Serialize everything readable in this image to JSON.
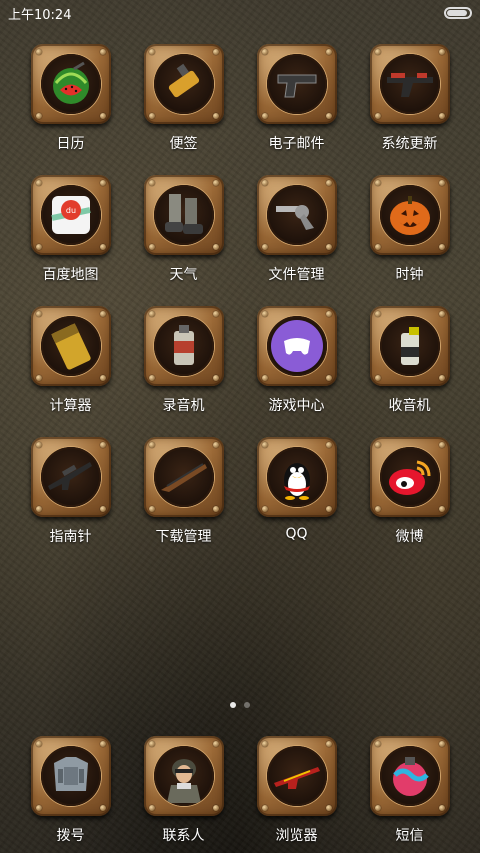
{
  "status_bar": {
    "time": "上午10:24",
    "battery_level": 0.9
  },
  "apps": [
    {
      "label": "日历",
      "icon": "watermelon-icon"
    },
    {
      "label": "便签",
      "icon": "grenade-icon"
    },
    {
      "label": "电子邮件",
      "icon": "pistol-icon"
    },
    {
      "label": "系统更新",
      "icon": "rifle-icon"
    },
    {
      "label": "百度地图",
      "icon": "baidu-map-icon"
    },
    {
      "label": "天气",
      "icon": "boots-icon"
    },
    {
      "label": "文件管理",
      "icon": "revolver-icon"
    },
    {
      "label": "时钟",
      "icon": "pumpkin-icon"
    },
    {
      "label": "计算器",
      "icon": "ammo-icon"
    },
    {
      "label": "录音机",
      "icon": "smoke-grenade-icon"
    },
    {
      "label": "游戏中心",
      "icon": "game-controller-icon"
    },
    {
      "label": "收音机",
      "icon": "flashbang-icon"
    },
    {
      "label": "指南针",
      "icon": "sniper-rifle-icon"
    },
    {
      "label": "下载管理",
      "icon": "shotgun-icon"
    },
    {
      "label": "QQ",
      "icon": "qq-penguin-icon"
    },
    {
      "label": "微博",
      "icon": "weibo-icon"
    }
  ],
  "page_indicator": {
    "count": 2,
    "active": 0
  },
  "dock": [
    {
      "label": "拨号",
      "icon": "armor-icon"
    },
    {
      "label": "联系人",
      "icon": "soldier-icon"
    },
    {
      "label": "浏览器",
      "icon": "dragon-rifle-icon"
    },
    {
      "label": "短信",
      "icon": "graffiti-grenade-icon"
    }
  ]
}
